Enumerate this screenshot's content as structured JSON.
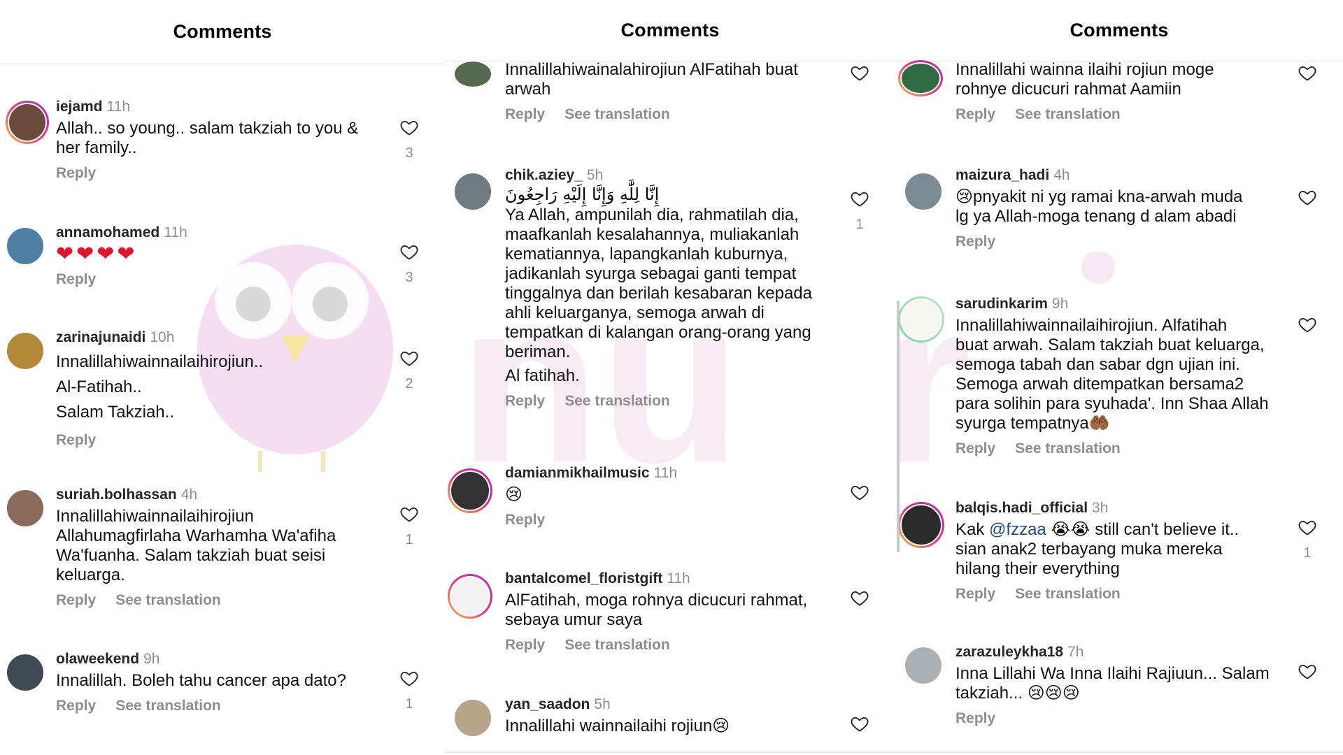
{
  "panels": [
    {
      "title": "Comments",
      "comments": [
        {
          "user": "iejamd",
          "time": "11h",
          "text": "Allah.. so young.. salam takziah to you &\nher family..",
          "actions": [
            "Reply"
          ],
          "likes": "3"
        },
        {
          "user": "annamohamed",
          "time": "11h",
          "text": "❤❤❤❤",
          "actions": [
            "Reply"
          ],
          "likes": "3"
        },
        {
          "user": "zarinajunaidi",
          "time": "10h",
          "text": "Innalillahiwainnailaihirojiun..\nAl-Fatihah..\nSalam Takziah..",
          "actions": [
            "Reply"
          ],
          "likes": "2"
        },
        {
          "user": "suriah.bolhassan",
          "time": "4h",
          "text": "Innalillahiwainnailaihirojiun\nAllahumagfirlaha Warhamha Wa'afiha\nWa'fuanha.  Salam takziah buat seisi\nkeluarga.",
          "actions": [
            "Reply",
            "See translation"
          ],
          "likes": "1"
        },
        {
          "user": "olaweekend",
          "time": "9h",
          "text": "Innalillah. Boleh tahu cancer apa dato?",
          "actions": [
            "Reply",
            "See translation"
          ],
          "likes": "1"
        }
      ]
    },
    {
      "title": "Comments",
      "comments": [
        {
          "user": "",
          "time": "",
          "text": "Innalillahiwainalahirojiun AlFatihah buat\narwah",
          "actions": [
            "Reply",
            "See translation"
          ],
          "likes": ""
        },
        {
          "user": "chik.aziey_",
          "time": "5h",
          "arabic": "إِنَّا لِلَّٰهِ وَإِنَّا إِلَيْهِ رَاجِعُونَ",
          "text": "Ya Allah, ampunilah dia, rahmatilah dia,\nmaafkanlah kesalahannya, muliakanlah\nkematiannya, lapangkanlah kuburnya,\njadikanlah syurga sebagai ganti tempat\ntinggalnya dan berilah kesabaran kepada\nahli keluarganya, semoga arwah di\ntempatkan di kalangan orang-orang yang\nberiman.",
          "text2": "Al fatihah.",
          "actions": [
            "Reply",
            "See translation"
          ],
          "likes": "1"
        },
        {
          "user": "damianmikhailmusic",
          "time": "11h",
          "text": "😢",
          "actions": [
            "Reply"
          ],
          "likes": ""
        },
        {
          "user": "bantalcomel_floristgift",
          "time": "11h",
          "text": "AlFatihah, moga rohnya dicucuri rahmat,\nsebaya umur saya",
          "actions": [
            "Reply",
            "See translation"
          ],
          "likes": ""
        },
        {
          "user": "yan_saadon",
          "time": "5h",
          "text": "Innalillahi wainnailaihi rojiun😢",
          "actions": [],
          "likes": ""
        }
      ]
    },
    {
      "title": "Comments",
      "comments": [
        {
          "user": "",
          "time": "",
          "text": "Innalillahi wainna ilaihi rojiun  moge\nrohnye dicucuri rahmat Aamiin",
          "actions": [
            "Reply",
            "See translation"
          ],
          "likes": ""
        },
        {
          "user": "maizura_hadi",
          "time": "4h",
          "text": "😢pnyakit ni yg ramai kna-arwah muda\nlg ya Allah-moga tenang d alam abadi",
          "actions": [
            "Reply"
          ],
          "likes": ""
        },
        {
          "user": "sarudinkarim",
          "time": "9h",
          "text": "Innalillahiwainnailaihirojiun. Alfatihah\nbuat arwah. Salam takziah buat keluarga,\nsemoga tabah dan sabar dgn ujian ini.\nSemoga arwah ditempatkan bersama2\npara solihin para syuhada'. Inn Shaa Allah\nsyurga tempatnya🤲🏾",
          "actions": [
            "Reply",
            "See translation"
          ],
          "likes": ""
        },
        {
          "user": "balqis.hadi_official",
          "time": "3h",
          "text_pre": "Kak ",
          "mention": "@fzzaa",
          "text_post": " 😭😭 still can't believe it..\nsian anak2 terbayang muka mereka\nhilang their everything",
          "actions": [
            "Reply",
            "See translation"
          ],
          "likes": "1"
        },
        {
          "user": "zarazuleykha18",
          "time": "7h",
          "text": "Inna Lillahi Wa Inna Ilaihi Rajiuun... Salam\ntakziah... 😢😢😢",
          "actions": [
            "Reply"
          ],
          "likes": ""
        }
      ]
    }
  ],
  "colors": {
    "accent": "#ea2f7a",
    "muted": "#8e8e8e",
    "mention": "#1e4b8f",
    "heart": "#e0152d"
  },
  "icons": {
    "like": "heart-outline-icon"
  }
}
